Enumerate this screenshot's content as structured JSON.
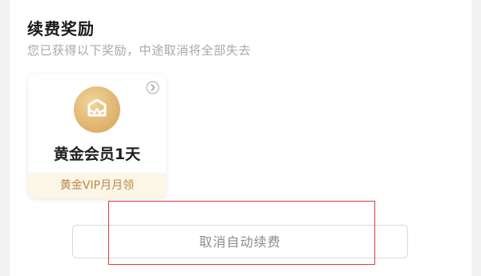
{
  "section": {
    "title": "续费奖励",
    "subtitle": "您已获得以下奖励，中途取消将全部失去"
  },
  "reward_card": {
    "icon": "crown-badge-icon",
    "title": "黄金会员1天",
    "footer": "黄金VIP月月领",
    "accent_color": "#ddb06a"
  },
  "actions": {
    "cancel_auto_renew_label": "取消自动续费"
  },
  "colors": {
    "highlight_border": "#e33b3b",
    "footer_text": "#b8884a",
    "footer_bg": "#fcf6e6"
  }
}
